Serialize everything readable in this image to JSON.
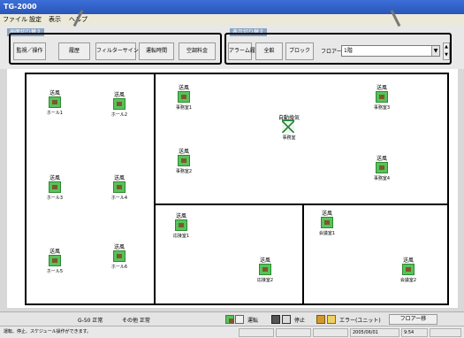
{
  "window": {
    "title": "TG-2000"
  },
  "menu": {
    "file": "ファイル",
    "settings": "設定",
    "other": "表示",
    "help": "ヘルプ"
  },
  "toolbar": {
    "left_group_label": "画面切り替え",
    "right_group_label": "表示切り替え",
    "buttons_left": [
      "監視／操作",
      "履歴",
      "フィルターサイン",
      "運転時間",
      "空調料金"
    ],
    "buttons_right": [
      "アラーム履歴",
      "全館",
      "ブロック"
    ],
    "floor_label": "フロアー",
    "floor_value": "1階"
  },
  "map": {
    "units": [
      {
        "mode": "送風",
        "name": "ホール1",
        "icon": "run"
      },
      {
        "mode": "送風",
        "name": "ホール2",
        "icon": "run"
      },
      {
        "mode": "送風",
        "name": "ホール3",
        "icon": "run"
      },
      {
        "mode": "送風",
        "name": "ホール4",
        "icon": "run"
      },
      {
        "mode": "送風",
        "name": "ホール5",
        "icon": "run"
      },
      {
        "mode": "送風",
        "name": "ホール6",
        "icon": "run"
      },
      {
        "mode": "送風",
        "name": "事務室1",
        "icon": "run"
      },
      {
        "mode": "自動換気",
        "name": "事務室",
        "icon": "vent"
      },
      {
        "mode": "送風",
        "name": "事務室3",
        "icon": "run"
      },
      {
        "mode": "送風",
        "name": "事務室2",
        "icon": "run"
      },
      {
        "mode": "送風",
        "name": "事務室4",
        "icon": "run"
      },
      {
        "mode": "送風",
        "name": "応接室1",
        "icon": "run"
      },
      {
        "mode": "送風",
        "name": "応接室2",
        "icon": "run"
      },
      {
        "mode": "送風",
        "name": "会議室1",
        "icon": "run"
      },
      {
        "mode": "送風",
        "name": "会議室2",
        "icon": "run"
      }
    ]
  },
  "status": {
    "group50": "G-50 正常",
    "other": "その他 正常",
    "legend_run": "運転",
    "legend_stop": "停止",
    "legend_error": "エラー(ユニット)",
    "floor_button": "フロアー移",
    "message": "運転、停止、スケジュール操作ができます。",
    "date": "2005/06/01",
    "time": "9:54"
  },
  "colors": {
    "titlebar": "#2a55b8",
    "unit_green": "#58c25a",
    "toolbar_bg": "#e8e8e8"
  }
}
